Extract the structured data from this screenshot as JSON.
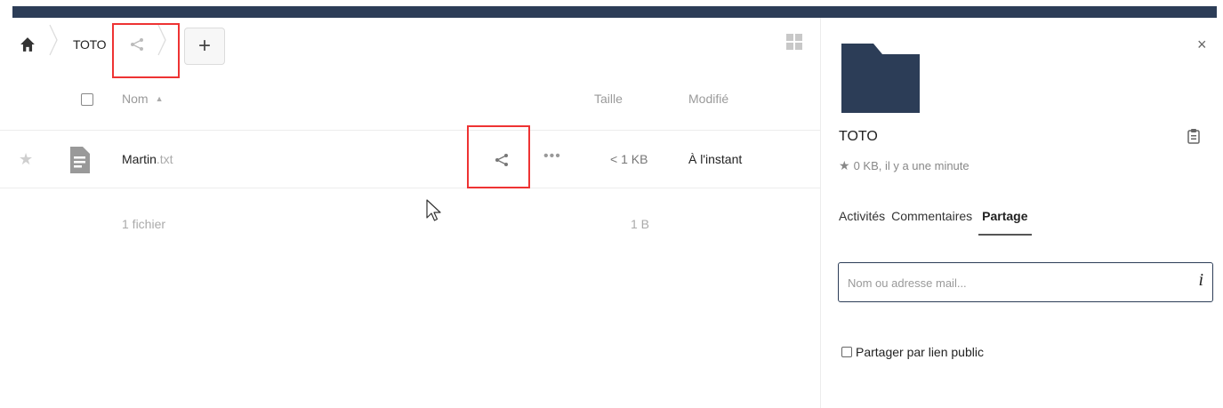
{
  "breadcrumb": {
    "folder": "TOTO"
  },
  "add_button": {
    "label": "+"
  },
  "table": {
    "headers": {
      "name": "Nom",
      "size": "Taille",
      "modified": "Modifié"
    },
    "rows": [
      {
        "name_base": "Martin",
        "name_ext": ".txt",
        "size": "< 1 KB",
        "modified": "À l'instant"
      }
    ],
    "summary": {
      "count": "1 fichier",
      "total": "1 B"
    }
  },
  "sidebar": {
    "title": "TOTO",
    "meta": "0 KB, il y a une minute",
    "close": "×",
    "tabs": [
      {
        "label": "Activités"
      },
      {
        "label": "Commentaires"
      },
      {
        "label": "Partage"
      }
    ],
    "share_input": {
      "placeholder": "Nom ou adresse mail..."
    },
    "info": "i",
    "public_link": "Partager par lien public"
  },
  "colors": {
    "accent": "#2c3d57",
    "highlight": "#e33333"
  },
  "icons": [
    "home-icon",
    "share-icon",
    "grid-view-icon",
    "star-icon",
    "file-text-icon",
    "more-icon",
    "folder-icon",
    "clipboard-icon",
    "close-icon",
    "info-icon"
  ]
}
